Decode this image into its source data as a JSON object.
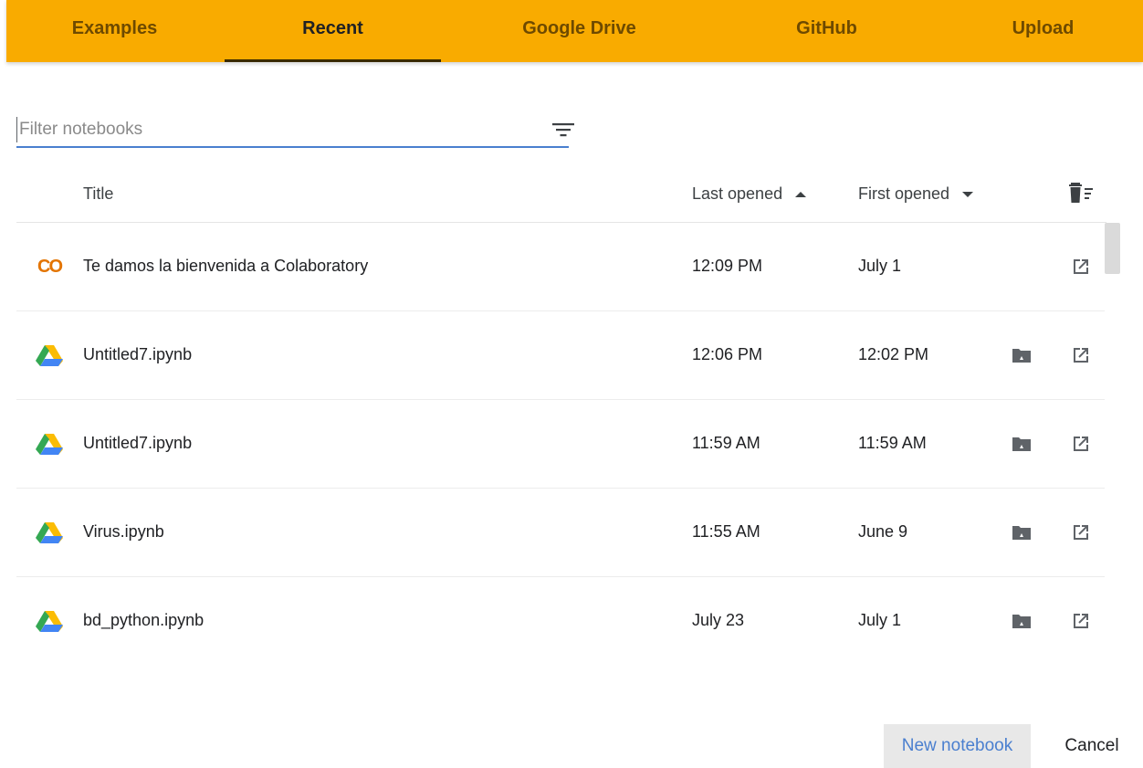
{
  "tabs": [
    {
      "label": "Examples",
      "active": false
    },
    {
      "label": "Recent",
      "active": true
    },
    {
      "label": "Google Drive",
      "active": false
    },
    {
      "label": "GitHub",
      "active": false
    },
    {
      "label": "Upload",
      "active": false
    }
  ],
  "filter": {
    "placeholder": "Filter notebooks",
    "value": ""
  },
  "columns": {
    "title": "Title",
    "last_opened": "Last opened",
    "first_opened": "First opened"
  },
  "rows": [
    {
      "icon": "colab-logo-icon",
      "title": "Te damos la bienvenida a Colaboratory",
      "last_opened": "12:09 PM",
      "first_opened": "July 1",
      "has_drive_folder": false
    },
    {
      "icon": "google-drive-icon",
      "title": "Untitled7.ipynb",
      "last_opened": "12:06 PM",
      "first_opened": "12:02 PM",
      "has_drive_folder": true
    },
    {
      "icon": "google-drive-icon",
      "title": "Untitled7.ipynb",
      "last_opened": "11:59 AM",
      "first_opened": "11:59 AM",
      "has_drive_folder": true
    },
    {
      "icon": "google-drive-icon",
      "title": "Virus.ipynb",
      "last_opened": "11:55 AM",
      "first_opened": "June 9",
      "has_drive_folder": true
    },
    {
      "icon": "google-drive-icon",
      "title": "bd_python.ipynb",
      "last_opened": "July 23",
      "first_opened": "July 1",
      "has_drive_folder": true
    }
  ],
  "colab_logo_text": "CO",
  "footer": {
    "new_notebook": "New notebook",
    "cancel": "Cancel"
  },
  "colors": {
    "tab_bar": "#f9ab00",
    "accent_blue": "#4a7fcf",
    "drive_green": "#34a853",
    "drive_yellow": "#fbbc04",
    "drive_blue": "#4285f4"
  }
}
